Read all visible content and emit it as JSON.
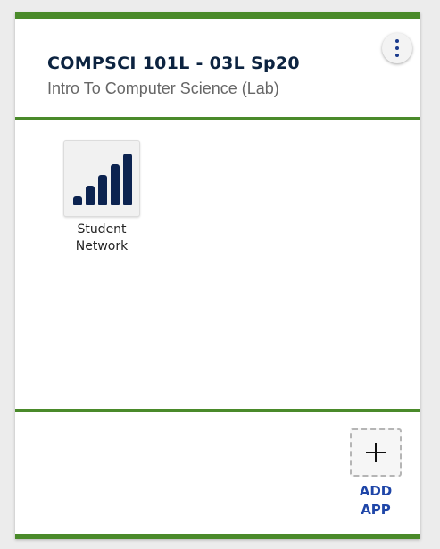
{
  "course": {
    "code": "COMPSCI 101L - 03L Sp20",
    "name": "Intro To Computer Science (Lab)"
  },
  "menu": {
    "icon": "vertical-dots-icon"
  },
  "apps": [
    {
      "label_line1": "Student",
      "label_line2": "Network",
      "icon": "signal-bars-icon"
    }
  ],
  "footer": {
    "add_label_line1": "ADD",
    "add_label_line2": "APP",
    "icon": "plus-icon"
  },
  "colors": {
    "accent_green": "#4a8a2a",
    "title_navy": "#0c2340",
    "link_blue": "#1f46a8",
    "icon_navy": "#0c2350"
  }
}
